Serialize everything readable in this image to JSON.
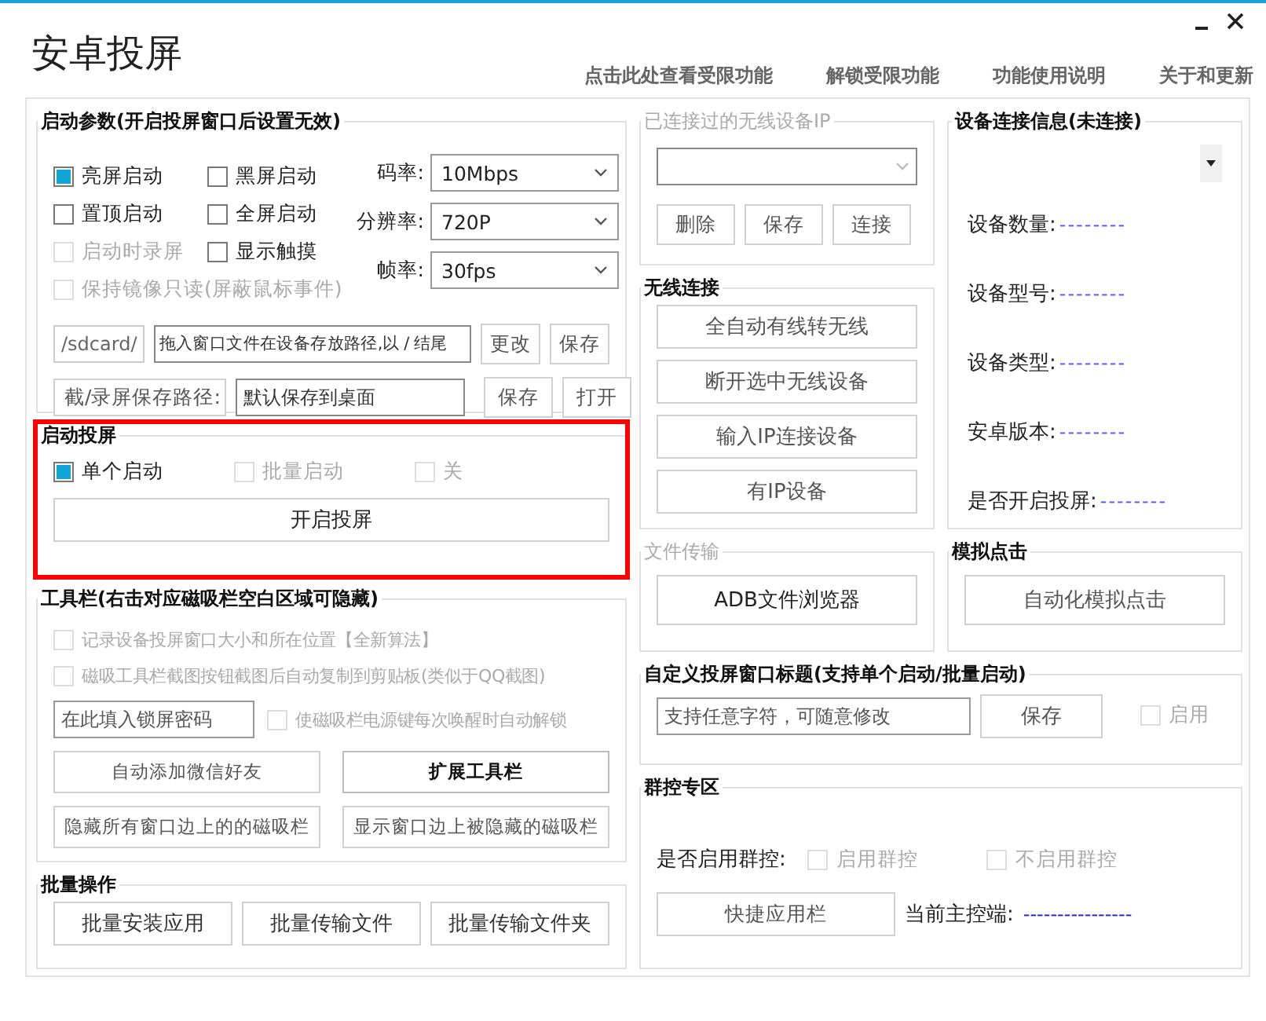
{
  "window": {
    "title": "安卓投屏"
  },
  "top_links": [
    "点击此处查看受限功能",
    "解锁受限功能",
    "功能使用说明",
    "关于和更新"
  ],
  "startup_params": {
    "title": "启动参数(开启投屏窗口后设置无效)",
    "options": [
      {
        "label": "亮屏启动",
        "checked": true,
        "disabled": false
      },
      {
        "label": "黑屏启动",
        "checked": false,
        "disabled": false
      },
      {
        "label": "置顶启动",
        "checked": false,
        "disabled": false
      },
      {
        "label": "全屏启动",
        "checked": false,
        "disabled": false
      },
      {
        "label": "启动时录屏",
        "checked": false,
        "disabled": true
      },
      {
        "label": "显示触摸",
        "checked": false,
        "disabled": false
      },
      {
        "label": "保持镜像只读(屏蔽鼠标事件)",
        "checked": false,
        "disabled": true
      }
    ],
    "selects": [
      {
        "label": "码率:",
        "value": "10Mbps"
      },
      {
        "label": "分辨率:",
        "value": "720P"
      },
      {
        "label": "帧率:",
        "value": "30fps"
      }
    ],
    "path_row": {
      "prefix": "/sdcard/",
      "value": "拖入窗口文件在设备存放路径,以 / 结尾",
      "buttons": [
        "更改",
        "保存"
      ]
    },
    "save_row": {
      "label": "截/录屏保存路径:",
      "value": "默认保存到桌面",
      "buttons": [
        "保存",
        "打开"
      ]
    }
  },
  "launch": {
    "title": "启动投屏",
    "highlighted": true,
    "options": [
      {
        "label": "单个启动",
        "selected": true,
        "disabled": false
      },
      {
        "label": "批量启动",
        "selected": false,
        "disabled": true
      },
      {
        "label": "关",
        "selected": false,
        "disabled": true
      }
    ],
    "button": "开启投屏"
  },
  "toolbar": {
    "title": "工具栏(右击对应磁吸栏空白区域可隐藏)",
    "options": [
      {
        "label": "记录设备投屏窗口大小和所在位置【全新算法】",
        "checked": false,
        "disabled": true
      },
      {
        "label": "磁吸工具栏截图按钮截图后自动复制到剪贴板(类似于QQ截图)",
        "checked": false,
        "disabled": true
      }
    ],
    "password": {
      "placeholder": "在此填入锁屏密码"
    },
    "unlock_option": {
      "label": "使磁吸栏电源键每次唤醒时自动解锁",
      "checked": false,
      "disabled": true
    },
    "buttons": [
      {
        "label": "自动添加微信好友",
        "emphasized": false
      },
      {
        "label": "扩展工具栏",
        "emphasized": true
      },
      {
        "label": "隐藏所有窗口边上的的磁吸栏",
        "emphasized": false
      },
      {
        "label": "显示窗口边上被隐藏的磁吸栏",
        "emphasized": false
      }
    ]
  },
  "batch": {
    "title": "批量操作",
    "buttons": [
      "批量安装应用",
      "批量传输文件",
      "批量传输文件夹"
    ]
  },
  "wifi_history": {
    "title": "已连接过的无线设备IP",
    "buttons": [
      "删除",
      "保存",
      "连接"
    ]
  },
  "wireless": {
    "title": "无线连接",
    "buttons": [
      "全自动有线转无线",
      "断开选中无线设备",
      "输入IP连接设备",
      "有IP设备"
    ]
  },
  "file_transfer": {
    "title": "文件传输",
    "button": "ADB文件浏览器"
  },
  "device_info": {
    "title": "设备连接信息(未连接)",
    "fields": [
      {
        "label": "设备数量:",
        "value": "--------"
      },
      {
        "label": "设备型号:",
        "value": "--------"
      },
      {
        "label": "设备类型:",
        "value": "--------"
      },
      {
        "label": "安卓版本:",
        "value": "--------"
      },
      {
        "label": "是否开启投屏:",
        "value": "--------"
      }
    ]
  },
  "simulate": {
    "title": "模拟点击",
    "button": "自动化模拟点击"
  },
  "custom_title": {
    "title": "自定义投屏窗口标题(支持单个启动/批量启动)",
    "placeholder": "支持任意字符，可随意修改",
    "button": "保存",
    "option": {
      "label": "启用",
      "checked": false,
      "disabled": true
    }
  },
  "group_control": {
    "title": "群控专区",
    "question": "是否启用群控:",
    "options": [
      {
        "label": "启用群控",
        "checked": false,
        "disabled": true
      },
      {
        "label": "不启用群控",
        "checked": false,
        "disabled": true
      }
    ],
    "button": "快捷应用栏",
    "master_label": "当前主控端:",
    "master_value": "----------------"
  }
}
